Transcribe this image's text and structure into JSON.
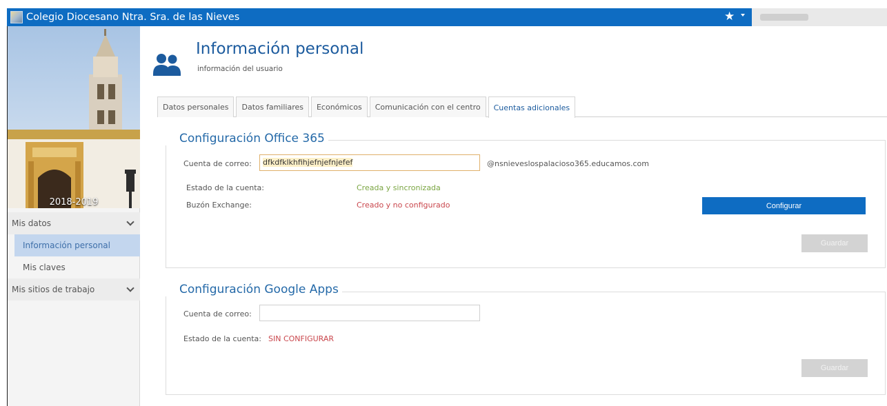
{
  "header": {
    "title": "Colegio Diocesano Ntra. Sra. de las Nieves",
    "logo_icon": "school-logo-icon",
    "favorites_icon": "star-icon"
  },
  "sidebar": {
    "year": "2018-2019",
    "items": [
      {
        "label": "Mis datos",
        "type": "section",
        "expanded": true
      },
      {
        "label": "Información personal",
        "type": "sub",
        "active": true
      },
      {
        "label": "Mis claves",
        "type": "sub",
        "active": false
      },
      {
        "label": "Mis sitios de trabajo",
        "type": "section",
        "expanded": false
      }
    ]
  },
  "page": {
    "title": "Información personal",
    "subtitle": "información del usuario",
    "icon": "users-icon"
  },
  "tabs": [
    {
      "label": "Datos personales",
      "active": false
    },
    {
      "label": "Datos familiares",
      "active": false
    },
    {
      "label": "Económicos",
      "active": false
    },
    {
      "label": "Comunicación con el centro",
      "active": false
    },
    {
      "label": "Cuentas adicionales",
      "active": true
    }
  ],
  "office": {
    "legend": "Configuración Office 365",
    "email_label": "Cuenta de correo:",
    "email_value": "dfkdfklkhfihjefnjefnjefef",
    "domain": "@nsnieveslospalacioso365.educamos.com",
    "status_label": "Estado de la cuenta:",
    "status_value": "Creada y sincronizada",
    "exchange_label": "Buzón Exchange:",
    "exchange_value": "Creado y no configurado",
    "configure_label": "Configurar",
    "save_label": "Guardar"
  },
  "google": {
    "legend": "Configuración Google Apps",
    "email_label": "Cuenta de correo:",
    "email_value": "",
    "status_label": "Estado de la cuenta:",
    "status_value": "SIN CONFIGURAR",
    "save_label": "Guardar"
  },
  "colors": {
    "header_blue": "#0e6cc2",
    "title_blue": "#1c5b9e",
    "status_green": "#7aa542",
    "status_red": "#c9464c"
  }
}
